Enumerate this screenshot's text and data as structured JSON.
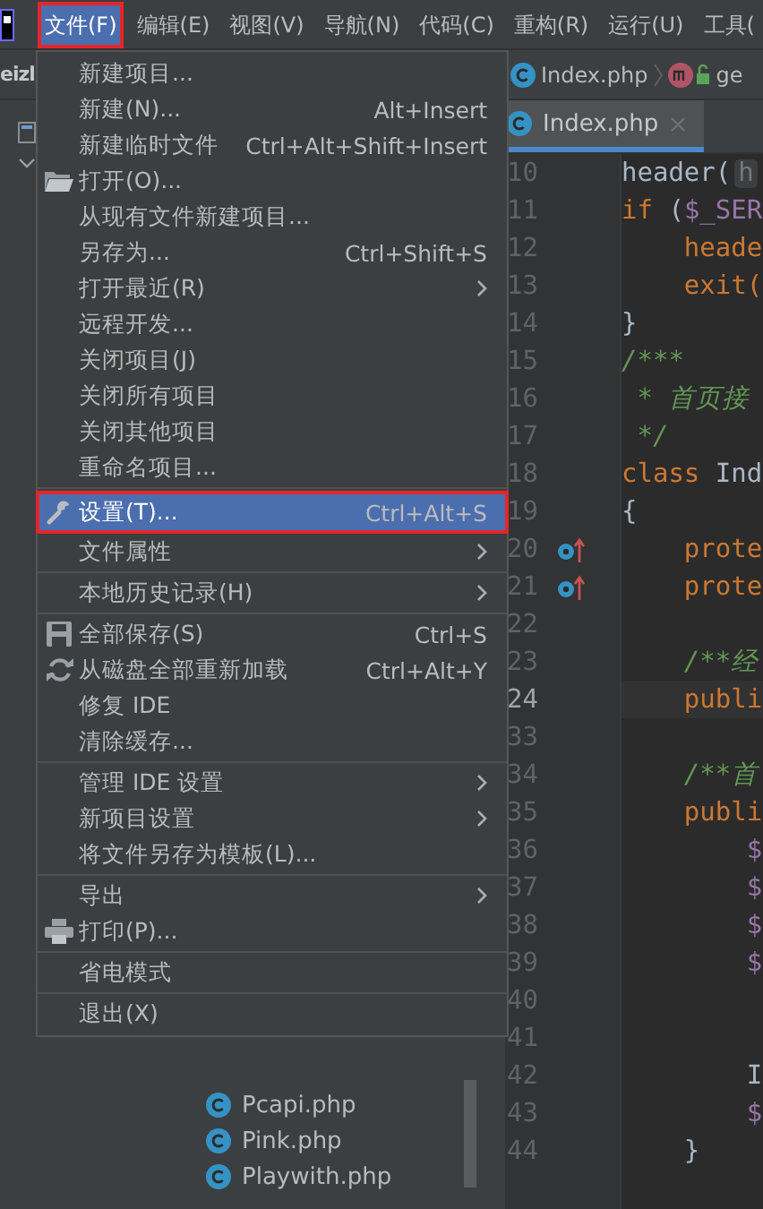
{
  "menu_bar": [
    {
      "label": "文件(F)",
      "selected": true,
      "marked": true
    },
    {
      "label": "编辑(E)",
      "selected": false,
      "marked": false
    },
    {
      "label": "视图(V)",
      "selected": false,
      "marked": false
    },
    {
      "label": "导航(N)",
      "selected": false,
      "marked": false
    },
    {
      "label": "代码(C)",
      "selected": false,
      "marked": false
    },
    {
      "label": "重构(R)",
      "selected": false,
      "marked": false
    },
    {
      "label": "运行(U)",
      "selected": false,
      "marked": false
    },
    {
      "label": "工具(",
      "selected": false,
      "marked": false
    }
  ],
  "project_label": "eizl",
  "breadcrumb": [
    {
      "label": "Index.php",
      "kind": "class"
    },
    {
      "label": "ge",
      "kind": "method"
    }
  ],
  "editor_tab": {
    "label": "Index.php"
  },
  "file_menu": [
    {
      "kind": "item",
      "label": "新建项目...",
      "selected": false,
      "marked": false
    },
    {
      "kind": "item",
      "label": "新建(N)...",
      "shortcut": "Alt+Insert",
      "selected": false,
      "marked": false
    },
    {
      "kind": "item",
      "label": "新建临时文件",
      "shortcut": "Ctrl+Alt+Shift+Insert",
      "selected": false,
      "marked": false
    },
    {
      "kind": "open",
      "label": "打开(O)...",
      "selected": false,
      "marked": false
    },
    {
      "kind": "item",
      "label": "从现有文件新建项目...",
      "selected": false,
      "marked": false
    },
    {
      "kind": "item",
      "label": "另存为...",
      "shortcut": "Ctrl+Shift+S",
      "selected": false,
      "marked": false
    },
    {
      "kind": "item",
      "label": "打开最近(R)",
      "submenu": true,
      "selected": false,
      "marked": false
    },
    {
      "kind": "item",
      "label": "远程开发...",
      "selected": false,
      "marked": false
    },
    {
      "kind": "item",
      "label": "关闭项目(J)",
      "selected": false,
      "marked": false
    },
    {
      "kind": "item",
      "label": "关闭所有项目",
      "selected": false,
      "marked": false
    },
    {
      "kind": "item",
      "label": "关闭其他项目",
      "selected": false,
      "marked": false
    },
    {
      "kind": "item",
      "label": "重命名项目...",
      "selected": false,
      "marked": false
    },
    {
      "kind": "separator"
    },
    {
      "kind": "settings",
      "label": "设置(T)...",
      "shortcut": "Ctrl+Alt+S",
      "selected": true,
      "marked": true
    },
    {
      "kind": "item",
      "label": "文件属性",
      "submenu": true,
      "selected": false,
      "marked": false
    },
    {
      "kind": "separator"
    },
    {
      "kind": "item",
      "label": "本地历史记录(H)",
      "submenu": true,
      "selected": false,
      "marked": false
    },
    {
      "kind": "separator"
    },
    {
      "kind": "save",
      "label": "全部保存(S)",
      "shortcut": "Ctrl+S",
      "selected": false,
      "marked": false
    },
    {
      "kind": "reload",
      "label": "从磁盘全部重新加载",
      "shortcut": "Ctrl+Alt+Y",
      "selected": false,
      "marked": false
    },
    {
      "kind": "item",
      "label": "修复 IDE",
      "selected": false,
      "marked": false
    },
    {
      "kind": "item",
      "label": "清除缓存...",
      "selected": false,
      "marked": false
    },
    {
      "kind": "separator"
    },
    {
      "kind": "item",
      "label": "管理 IDE 设置",
      "submenu": true,
      "selected": false,
      "marked": false
    },
    {
      "kind": "item",
      "label": "新项目设置",
      "submenu": true,
      "selected": false,
      "marked": false
    },
    {
      "kind": "item",
      "label": "将文件另存为模板(L)...",
      "selected": false,
      "marked": false
    },
    {
      "kind": "separator"
    },
    {
      "kind": "item",
      "label": "导出",
      "submenu": true,
      "selected": false,
      "marked": false
    },
    {
      "kind": "print",
      "label": "打印(P)...",
      "selected": false,
      "marked": false
    },
    {
      "kind": "separator"
    },
    {
      "kind": "item",
      "label": "省电模式",
      "selected": false,
      "marked": false
    },
    {
      "kind": "separator"
    },
    {
      "kind": "item",
      "label": "退出(X)",
      "selected": false,
      "marked": false
    }
  ],
  "project_tree": [
    {
      "label": "Pcapi.php"
    },
    {
      "label": "Pink.php"
    },
    {
      "label": "Playwith.php"
    }
  ],
  "editor": {
    "lines": [
      {
        "number": "10",
        "tokens": [
          {
            "kind": "plain",
            "text": "header("
          },
          {
            "kind": "hint",
            "text": "h"
          }
        ]
      },
      {
        "number": "11",
        "tokens": [
          {
            "kind": "keyword",
            "text": "if"
          },
          {
            "kind": "plain",
            "text": " ("
          },
          {
            "kind": "var",
            "text": "$_SER"
          }
        ]
      },
      {
        "number": "12",
        "tokens": [
          {
            "kind": "keyword",
            "text": "    heade"
          }
        ]
      },
      {
        "number": "13",
        "tokens": [
          {
            "kind": "keyword",
            "text": "    exit("
          }
        ]
      },
      {
        "number": "14",
        "tokens": [
          {
            "kind": "plain",
            "text": "}"
          }
        ]
      },
      {
        "number": "15",
        "tokens": [
          {
            "kind": "comment",
            "text": "/***"
          }
        ]
      },
      {
        "number": "16",
        "tokens": [
          {
            "kind": "comment",
            "text": " * 首页接"
          }
        ]
      },
      {
        "number": "17",
        "tokens": [
          {
            "kind": "comment",
            "text": " */"
          }
        ]
      },
      {
        "number": "18",
        "tokens": [
          {
            "kind": "keyword",
            "text": "class"
          },
          {
            "kind": "plain",
            "text": " Ind"
          }
        ]
      },
      {
        "number": "19",
        "tokens": [
          {
            "kind": "plain",
            "text": "{"
          }
        ]
      },
      {
        "number": "20",
        "gutter_icon": true,
        "tokens": [
          {
            "kind": "keyword",
            "text": "    prote"
          }
        ]
      },
      {
        "number": "21",
        "gutter_icon": true,
        "tokens": [
          {
            "kind": "keyword",
            "text": "    prote"
          }
        ]
      },
      {
        "number": "22"
      },
      {
        "number": "23",
        "tokens": [
          {
            "kind": "comment",
            "text": "    /**经"
          }
        ]
      },
      {
        "number": "24",
        "current": true,
        "tokens": [
          {
            "kind": "keyword",
            "text": "    publi"
          }
        ]
      },
      {
        "number": "33"
      },
      {
        "number": "34",
        "tokens": [
          {
            "kind": "comment",
            "text": "    /**首"
          }
        ]
      },
      {
        "number": "35",
        "tokens": [
          {
            "kind": "keyword",
            "text": "    publi"
          }
        ]
      },
      {
        "number": "36",
        "tokens": [
          {
            "kind": "var",
            "text": "        $"
          }
        ]
      },
      {
        "number": "37",
        "tokens": [
          {
            "kind": "var",
            "text": "        $"
          }
        ]
      },
      {
        "number": "38",
        "tokens": [
          {
            "kind": "var",
            "text": "        $"
          }
        ]
      },
      {
        "number": "39",
        "tokens": [
          {
            "kind": "var",
            "text": "        $"
          }
        ]
      },
      {
        "number": "40"
      },
      {
        "number": "41"
      },
      {
        "number": "42",
        "tokens": [
          {
            "kind": "plain",
            "text": "        I"
          }
        ]
      },
      {
        "number": "43",
        "tokens": [
          {
            "kind": "var",
            "text": "        $"
          }
        ]
      },
      {
        "number": "44",
        "tokens": [
          {
            "kind": "plain",
            "text": "    }"
          }
        ]
      }
    ]
  }
}
